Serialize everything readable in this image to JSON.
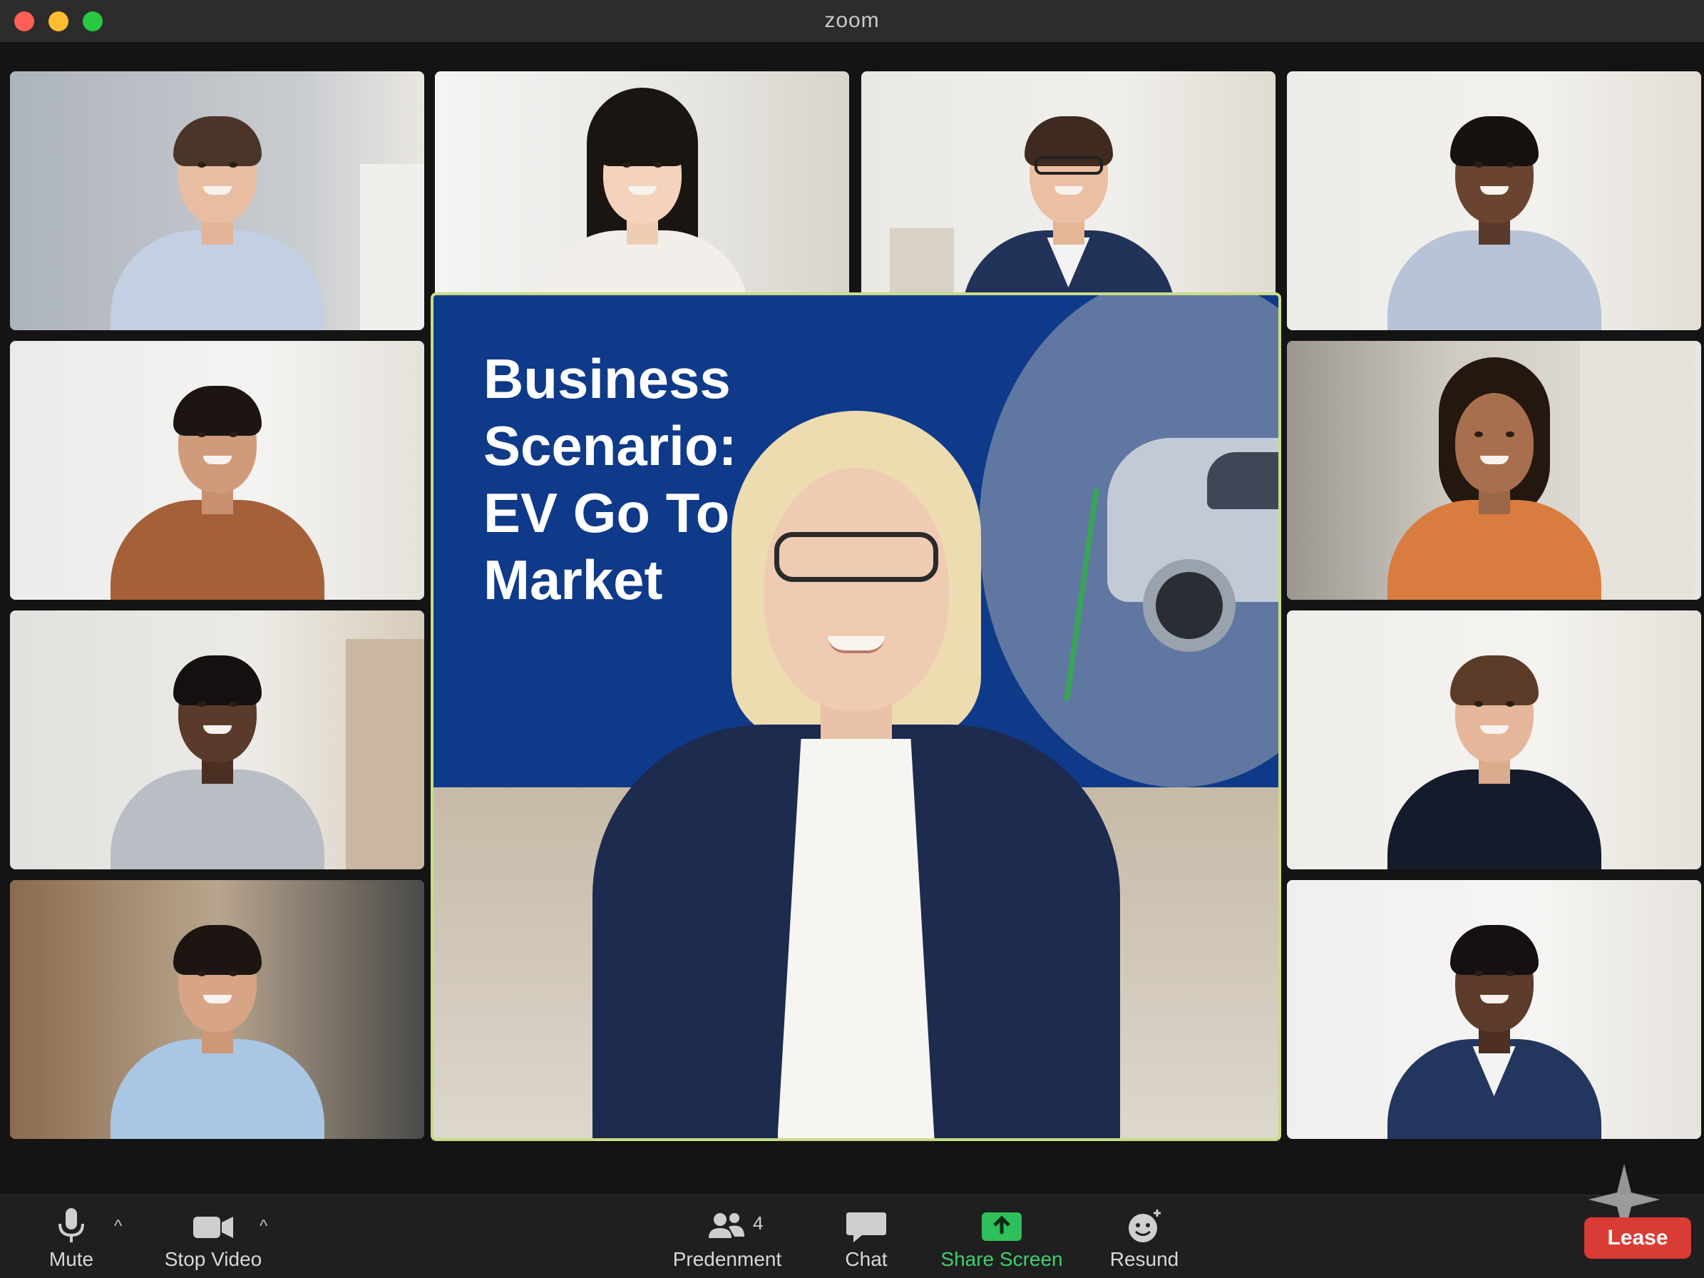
{
  "window": {
    "title": "zoom"
  },
  "presentation": {
    "slide_title": "Business Scenario: EV Go To Market"
  },
  "toolbar": {
    "mute_label": "Mute",
    "stop_video_label": "Stop Video",
    "participants_label": "Predenment",
    "participants_count": "4",
    "chat_label": "Chat",
    "share_screen_label": "Share Screen",
    "reactions_label": "Resund",
    "leave_label": "Lease"
  },
  "colors": {
    "active_speaker_border": "#c8dc86",
    "share_green": "#3fcf6b",
    "leave_red": "#d93b35",
    "slide_blue": "#0f3a8a"
  },
  "icons": [
    "microphone-icon",
    "video-camera-icon",
    "participants-icon",
    "chat-bubble-icon",
    "share-screen-icon",
    "reactions-icon",
    "sparkle-watermark-icon"
  ]
}
